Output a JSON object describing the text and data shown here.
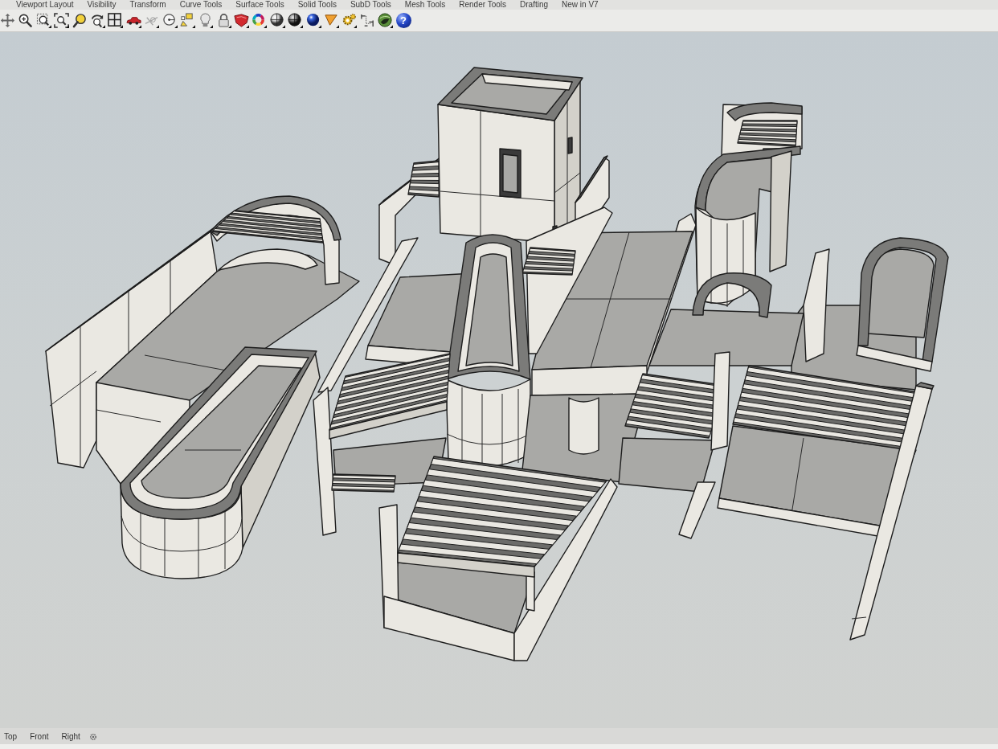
{
  "ribbon_tabs": [
    "Viewport Layout",
    "Visibility",
    "Transform",
    "Curve Tools",
    "Surface Tools",
    "Solid Tools",
    "SubD Tools",
    "Mesh Tools",
    "Render Tools",
    "Drafting",
    "New in V7"
  ],
  "toolbar": {
    "help_glyph": "?"
  },
  "viewport_tabs": [
    {
      "label": "Top",
      "selected": false
    },
    {
      "label": "Front",
      "selected": false
    },
    {
      "label": "Right",
      "selected": false
    }
  ]
}
